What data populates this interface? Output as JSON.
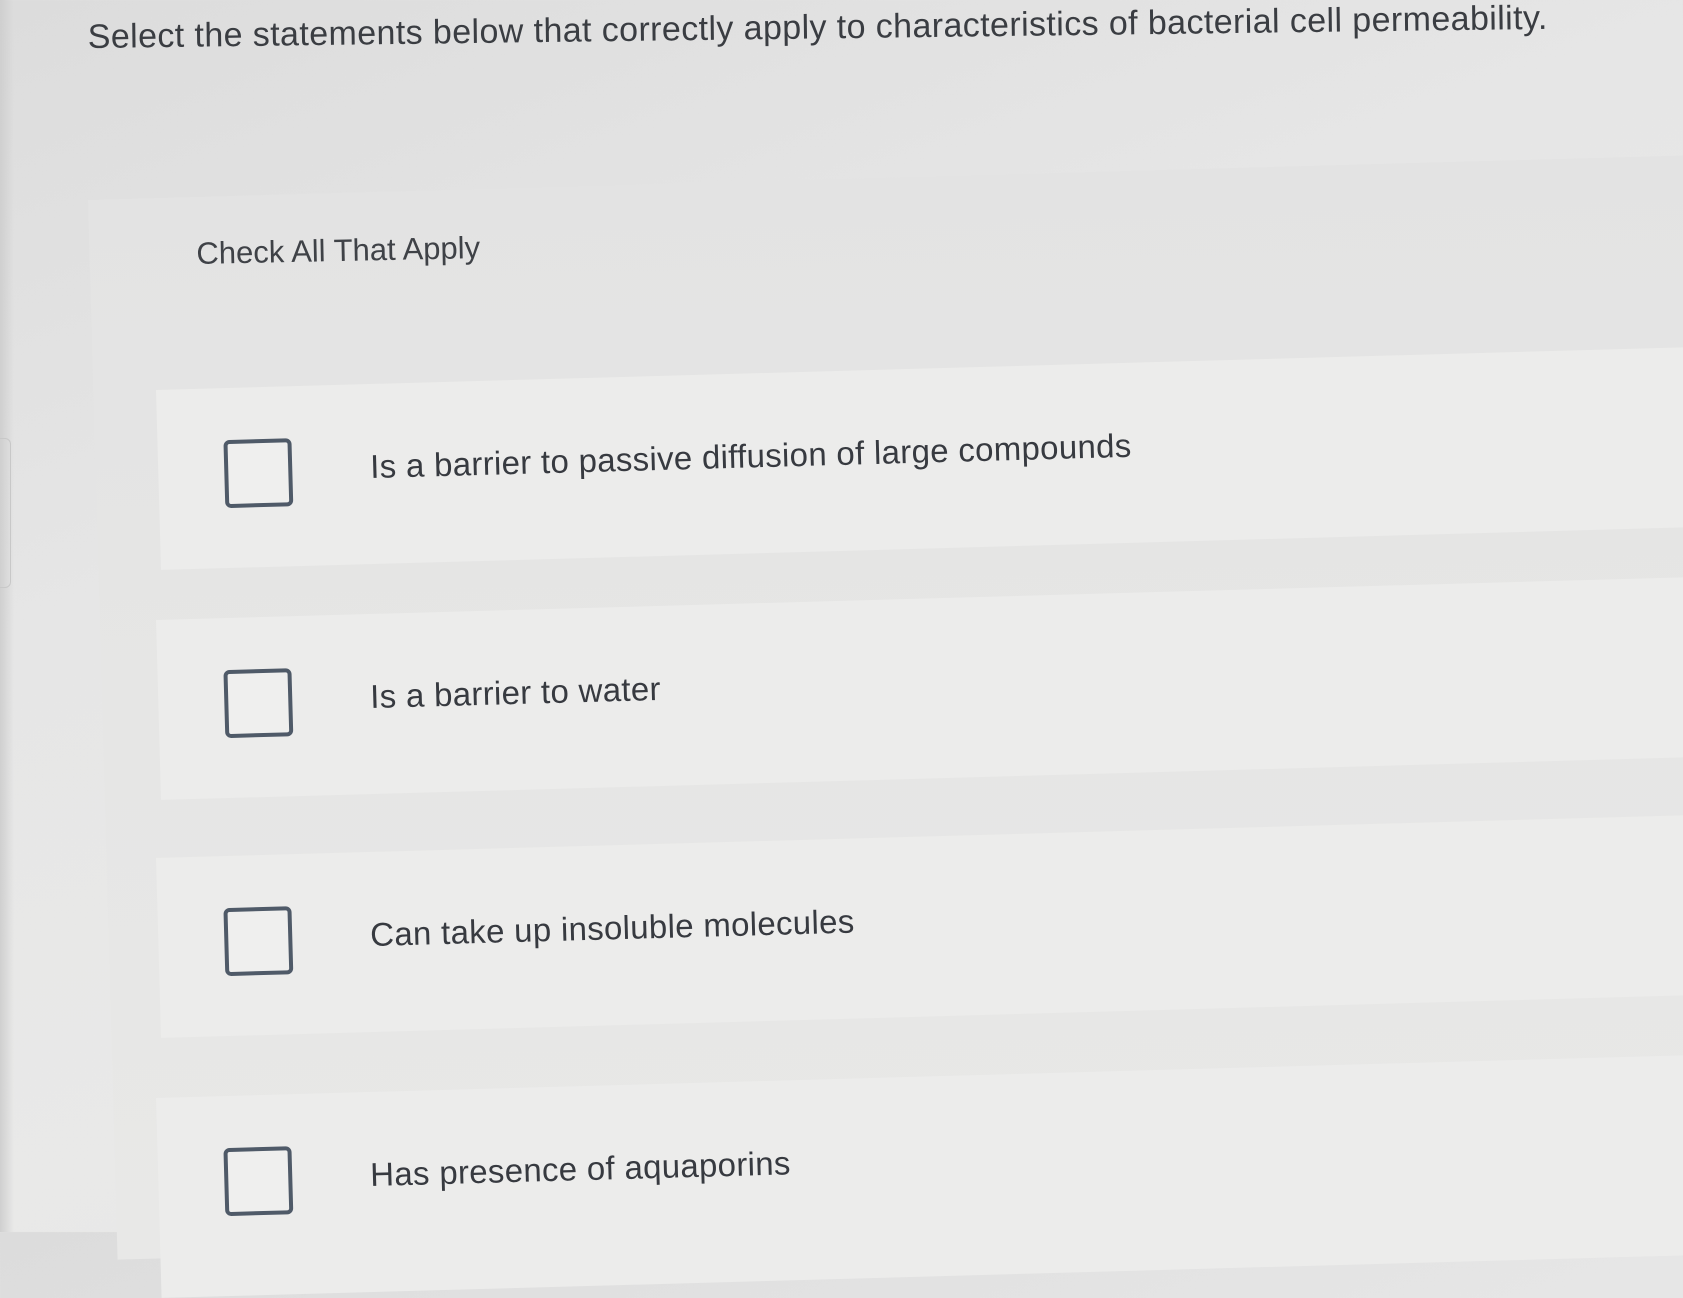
{
  "question": {
    "text": "Select the statements below that correctly apply to characteristics of bacterial cell permeability."
  },
  "instruction": {
    "text": "Check All That Apply"
  },
  "options": [
    {
      "label": "Is a barrier to passive diffusion of large compounds",
      "checked": false
    },
    {
      "label": "Is a barrier to water",
      "checked": false
    },
    {
      "label": "Can take up insoluble molecules",
      "checked": false
    },
    {
      "label": "Has presence of aquaporins",
      "checked": false
    }
  ],
  "colors": {
    "background": "#e6e6e5",
    "option_background": "#ececeb",
    "checkbox_border": "#4f5a68",
    "text": "#3a3d42"
  }
}
